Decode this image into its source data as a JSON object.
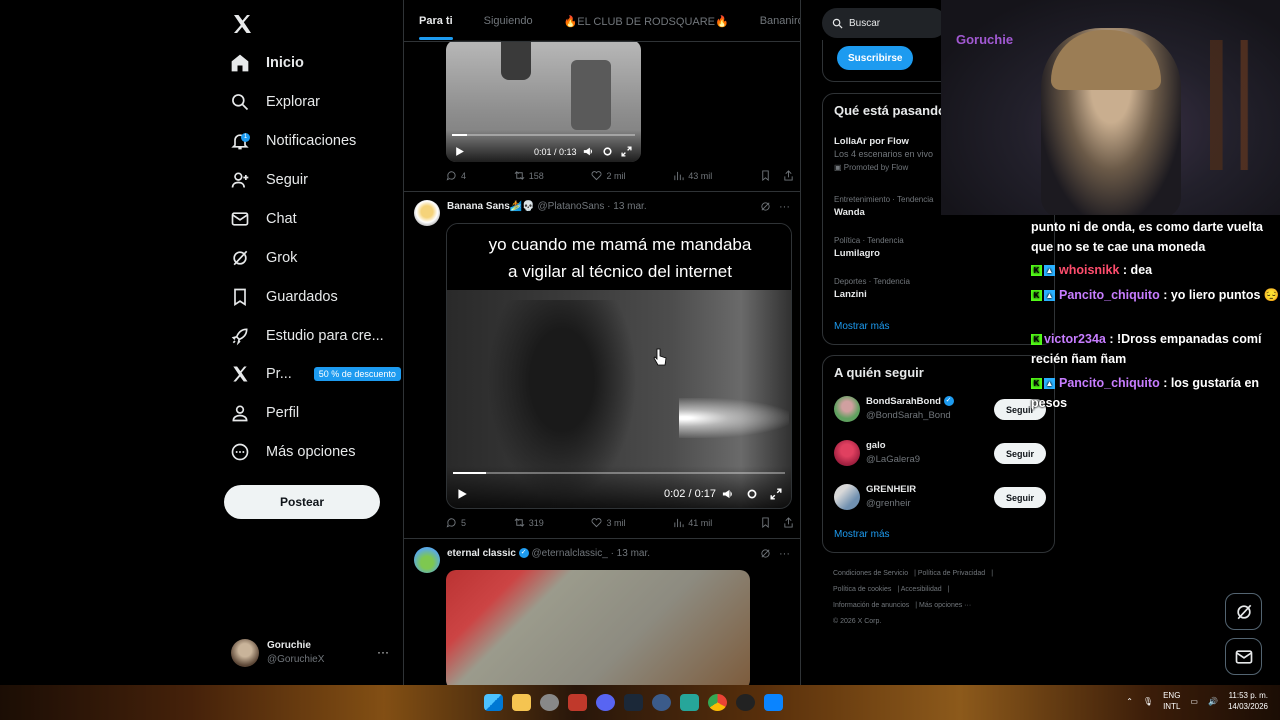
{
  "sidebar": {
    "nav": [
      {
        "label": "Inicio",
        "icon": "home-icon"
      },
      {
        "label": "Explorar",
        "icon": "search-icon"
      },
      {
        "label": "Notificaciones",
        "icon": "bell-icon",
        "badge": "1"
      },
      {
        "label": "Seguir",
        "icon": "add-user-icon"
      },
      {
        "label": "Chat",
        "icon": "mail-icon"
      },
      {
        "label": "Grok",
        "icon": "grok-icon"
      },
      {
        "label": "Guardados",
        "icon": "bookmark-icon"
      },
      {
        "label": "Estudio para cre...",
        "icon": "rocket-icon"
      },
      {
        "label": "Pr...",
        "icon": "x-premium-icon",
        "promo": "50 % de descuento"
      },
      {
        "label": "Perfil",
        "icon": "person-icon"
      },
      {
        "label": "Más opciones",
        "icon": "more-circle-icon"
      }
    ],
    "post_button": "Postear",
    "account": {
      "name": "Goruchie",
      "handle": "@GoruchieX",
      "more": "···"
    }
  },
  "feed": {
    "tabs": [
      "Para ti",
      "Siguiendo",
      "🔥EL CLUB DE RODSQUARE🔥",
      "Bananirou"
    ],
    "tweet1": {
      "video_time": "0:01 / 0:13",
      "progress": 0.08,
      "stats": {
        "replies": "4",
        "reposts": "158",
        "likes": "2 mil",
        "views": "43 mil"
      }
    },
    "tweet2": {
      "name": "Banana Sans🏄💀",
      "handle": "@PlatanoSans",
      "date": "· 13 mar.",
      "caption_line1": "yo cuando me mamá me mandaba",
      "caption_line2": "a vigilar al técnico del internet",
      "video_time": "0:02 / 0:17",
      "progress": 0.1,
      "stats": {
        "replies": "5",
        "reposts": "319",
        "likes": "3 mil",
        "views": "41 mil"
      }
    },
    "tweet3": {
      "name": "eternal classic",
      "handle": "@eternalclassic_",
      "date": "· 13 mar."
    }
  },
  "right": {
    "search_placeholder": "Buscar",
    "subscribe_button": "Suscribirse",
    "trends_title": "Qué está pasando",
    "trends": [
      {
        "category": "",
        "name": "LollaAr por Flow",
        "desc": "Los 4 escenarios en vivo",
        "promo": "Promoted by Flow"
      },
      {
        "category": "Entretenimiento · Tendencia",
        "name": "Wanda"
      },
      {
        "category": "Política · Tendencia",
        "name": "Lumilagro"
      },
      {
        "category": "Deportes · Tendencia",
        "name": "Lanzini"
      }
    ],
    "trends_more": "Mostrar más",
    "who_title": "A quién seguir",
    "who": [
      {
        "name": "BondSarahBond",
        "handle": "@BondSarah_Bond",
        "verified": true,
        "button": "Seguir"
      },
      {
        "name": "galo",
        "handle": "@LaGalera9",
        "verified": false,
        "button": "Seguir"
      },
      {
        "name": "GRENHEIR",
        "handle": "@grenheir",
        "verified": false,
        "button": "Seguir"
      }
    ],
    "who_more": "Mostrar más",
    "footer": [
      "Condiciones de Servicio",
      "Política de Privacidad",
      "Política de cookies",
      "Accesibilidad",
      "Información de anuncios",
      "Más opciones ···",
      "© 2026 X Corp."
    ]
  },
  "stream": {
    "webcam_sign": "Goruchie",
    "chat": [
      {
        "user": "",
        "text": "punto ni de onda, es como darte vuelta que no se te cae una moneda",
        "color": "#ffffff"
      },
      {
        "user": "whoisnikk",
        "text": ": dea",
        "color": "#ff4d6d"
      },
      {
        "user": "Pancito_chiquito",
        "text": ": yo liero puntos 😔",
        "color": "#c77dff"
      },
      {
        "user": "victor234a",
        "text": ": !Dross empanadas comí recién ñam ñam",
        "color": "#c77dff"
      },
      {
        "user": "Pancito_chiquito",
        "text": ": los gustaría en pesos",
        "color": "#c77dff"
      }
    ]
  },
  "taskbar": {
    "lang1": "ENG",
    "lang2": "INTL",
    "time": "11:53 p. m.",
    "date": "14/03/2026"
  },
  "colors": {
    "accent": "#1d9bf0",
    "background": "#000000",
    "border": "#2f3336",
    "muted": "#71767b"
  }
}
